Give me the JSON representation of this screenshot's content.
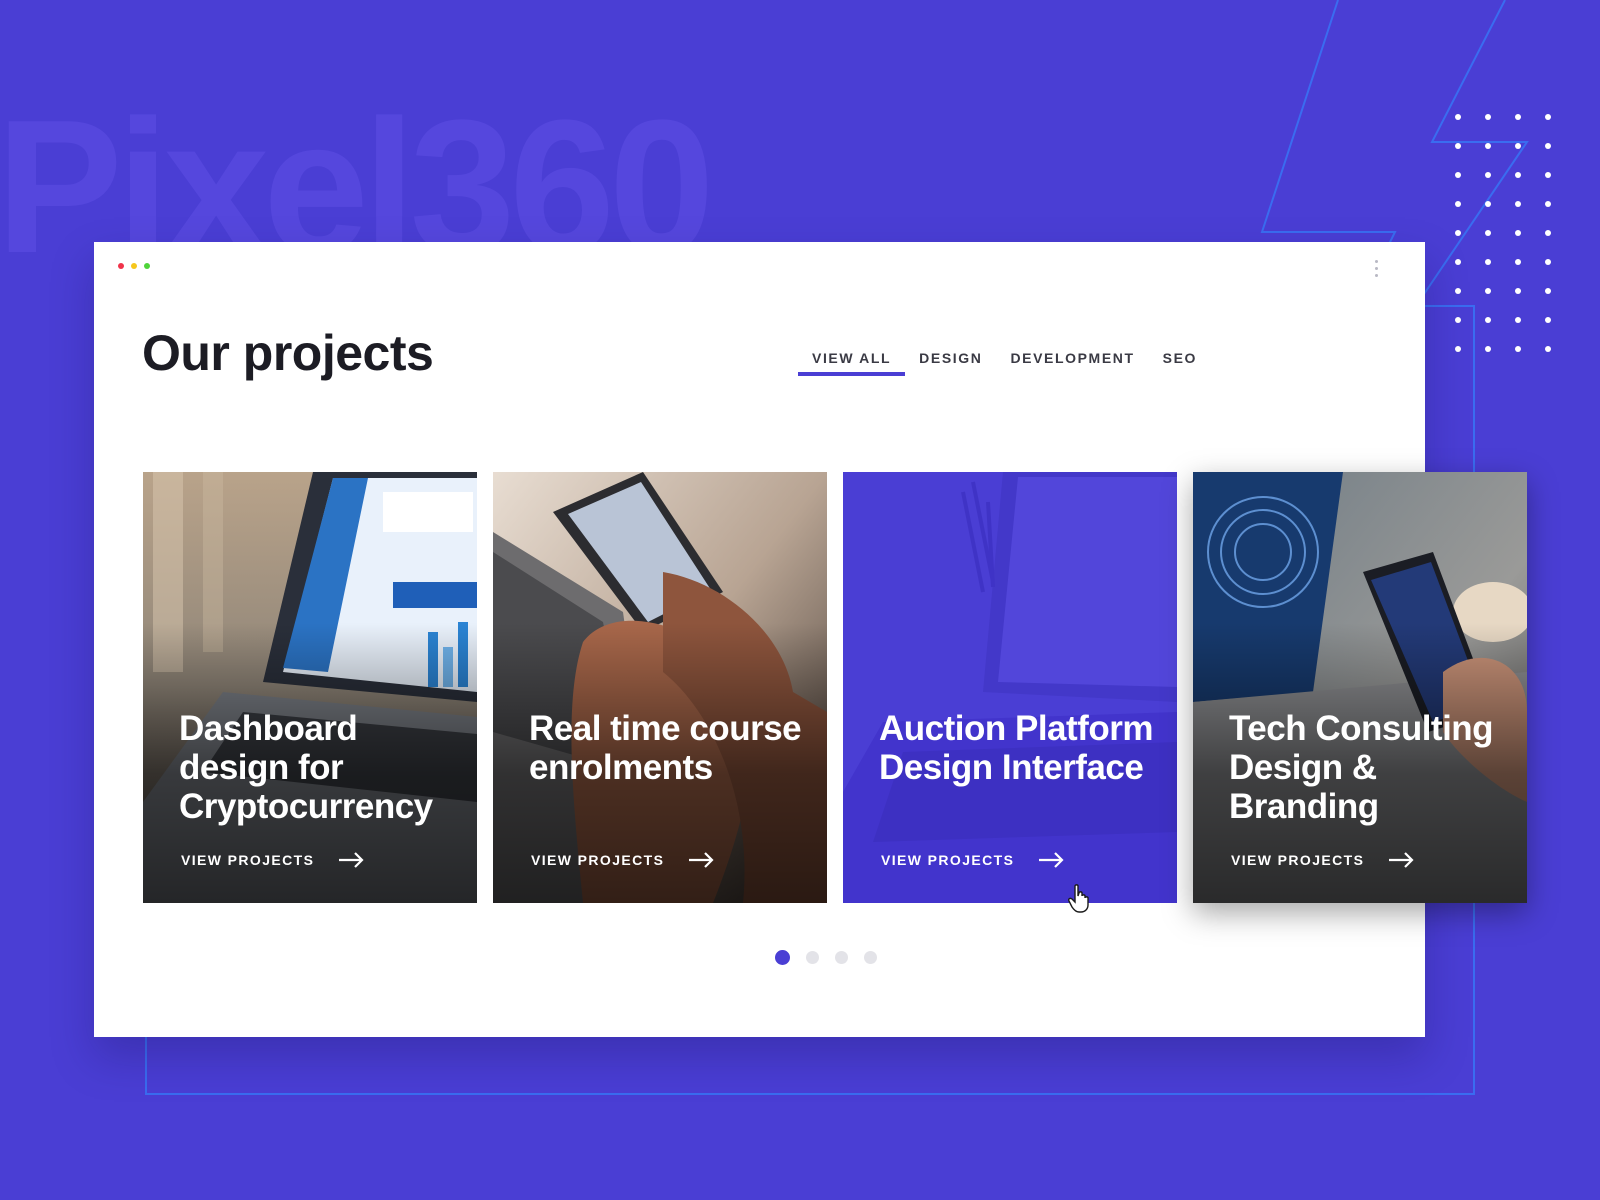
{
  "brand_watermark": "Pixel360",
  "colors": {
    "background": "#4a3ed4",
    "accent": "#4a3ed4",
    "line_deco": "#3a6cf0",
    "traffic_red": "#f0334a",
    "traffic_yellow": "#f6c71c",
    "traffic_green": "#4fd43a"
  },
  "window": {
    "controls": [
      "close-dot",
      "minimize-dot",
      "maximize-dot"
    ],
    "menu_icon": "kebab-menu-icon"
  },
  "page": {
    "title": "Our projects"
  },
  "tabs": [
    {
      "label": "VIEW ALL",
      "active": true
    },
    {
      "label": "DESIGN",
      "active": false
    },
    {
      "label": "DEVELOPMENT",
      "active": false
    },
    {
      "label": "SEO",
      "active": false
    }
  ],
  "cards": [
    {
      "title": "Dashboard design for Cryptocurrency",
      "link": "VIEW PROJECTS",
      "image": "laptop-crypto-dashboard-photo"
    },
    {
      "title": "Real time course enrolments",
      "link": "VIEW PROJECTS",
      "image": "hands-smartphone-laptop-photo"
    },
    {
      "title": "Auction Platform Design Interface",
      "link": "VIEW PROJECTS",
      "image": "laptop-presentation-photo-tinted"
    },
    {
      "title": "Tech Consulting Design & Branding",
      "link": "VIEW PROJECTS",
      "image": "phone-fingerprint-laptop-photo"
    }
  ],
  "pagination": {
    "pages": 4,
    "current": 1
  }
}
